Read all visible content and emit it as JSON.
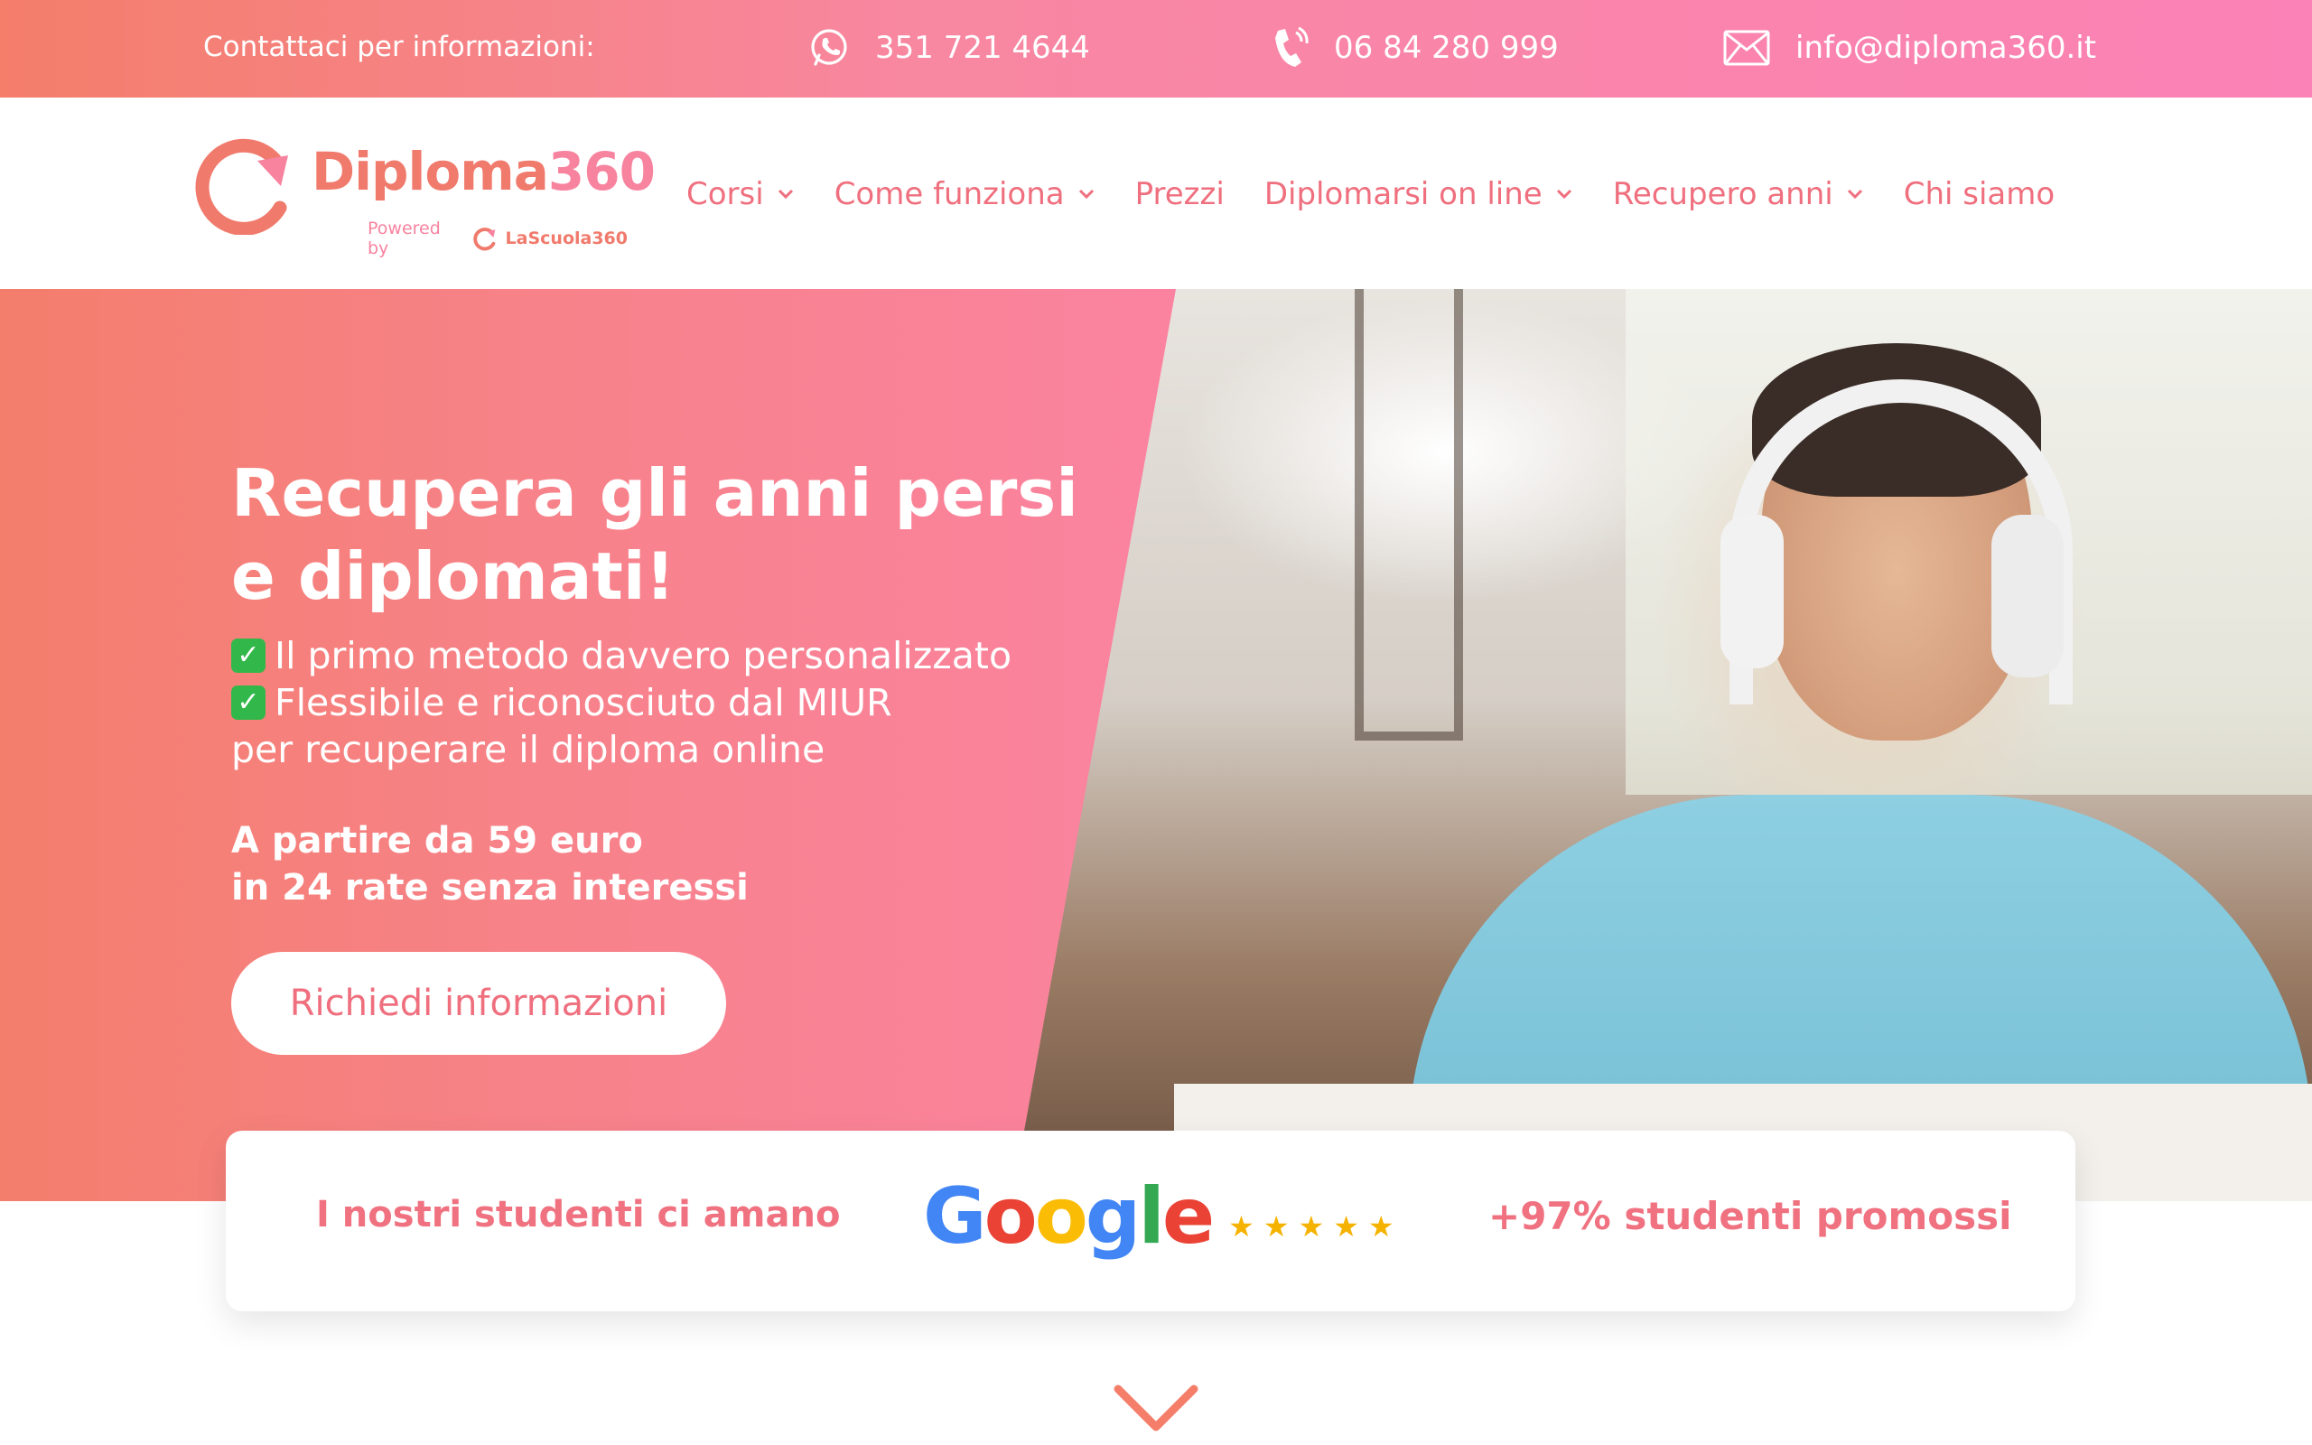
{
  "topbar": {
    "contact_label": "Contattaci per informazioni:",
    "whatsapp": {
      "icon": "whatsapp-icon",
      "text": "351 721 4644"
    },
    "phone": {
      "icon": "phone-icon",
      "text": "06 84 280 999"
    },
    "email": {
      "icon": "mail-icon",
      "text": "info@diploma360.it"
    }
  },
  "header": {
    "logo": {
      "name": "Diploma",
      "name_num": "360",
      "powered_by": "Powered by",
      "partner": "LaScuola360"
    },
    "nav": [
      {
        "label": "Corsi",
        "has_dropdown": true
      },
      {
        "label": "Come funziona",
        "has_dropdown": true
      },
      {
        "label": "Prezzi",
        "has_dropdown": false
      },
      {
        "label": "Diplomarsi on line",
        "has_dropdown": true
      },
      {
        "label": "Recupero anni",
        "has_dropdown": true
      },
      {
        "label": "Chi siamo",
        "has_dropdown": false
      }
    ]
  },
  "hero": {
    "title_line1": "Recupera gli anni persi",
    "title_line2": "e diplomati!",
    "bullet1": "Il primo metodo davvero personalizzato",
    "bullet2": "Flessibile e riconosciuto dal MIUR",
    "bullet_tail": "per recuperare il diploma online",
    "price_line1": "A partire da 59 euro",
    "price_line2": "in 24 rate senza interessi",
    "cta_label": "Richiedi informazioni"
  },
  "reviews": {
    "love_text": "I nostri studenti ci amano",
    "google_brand": "Google",
    "rating_stars": 5,
    "promo_text": "+97% studenti promossi"
  },
  "colors": {
    "brand_coral": "#f07a6c",
    "brand_pink": "#fb82b6",
    "accent_text": "#ef6f7e"
  }
}
